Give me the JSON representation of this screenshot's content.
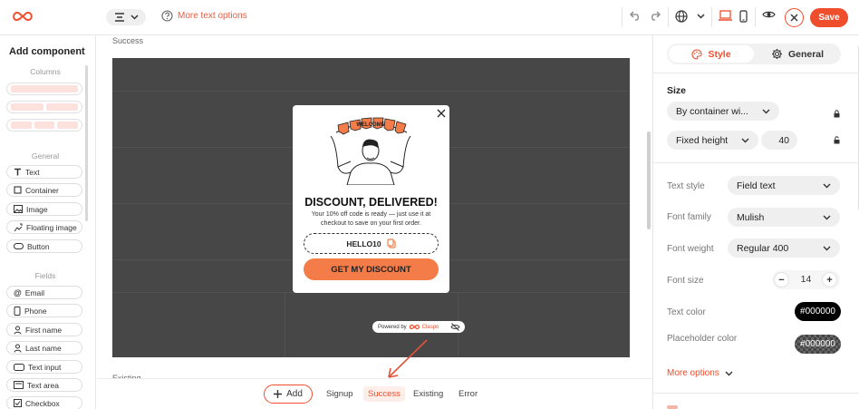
{
  "topbar": {
    "more_text_options": "More text options",
    "save_label": "Save"
  },
  "left_panel": {
    "title": "Add component",
    "columns_label": "Columns",
    "general_label": "General",
    "general_items": [
      "Text",
      "Container",
      "Image",
      "Floating image",
      "Button"
    ],
    "fields_label": "Fields",
    "field_items": [
      "Email",
      "Phone",
      "First name",
      "Last name",
      "Text input",
      "Text area",
      "Checkbox"
    ]
  },
  "canvas": {
    "label": "Success",
    "label_below": "Existing"
  },
  "popup": {
    "banner": "WELCOME",
    "headline": "DISCOUNT, DELIVERED!",
    "body": "Your 10% off code is ready — just use it at checkout to save on your first order.",
    "code": "HELLO10",
    "cta": "GET MY DISCOUNT",
    "powered_by": "Powered by",
    "brand": "Claspo"
  },
  "bottom_bar": {
    "add_label": "Add",
    "tabs": [
      "Signup",
      "Success",
      "Existing",
      "Error"
    ],
    "active_tab": "Success"
  },
  "right_panel": {
    "tabs": {
      "style": "Style",
      "general": "General"
    },
    "size_title": "Size",
    "width_mode": "By container wi...",
    "height_mode": "Fixed height",
    "height_value": "40",
    "text_style_label": "Text style",
    "text_style_value": "Field text",
    "font_family_label": "Font family",
    "font_family_value": "Mulish",
    "font_weight_label": "Font weight",
    "font_weight_value": "Regular 400",
    "font_size_label": "Font size",
    "font_size_value": "14",
    "text_color_label": "Text color",
    "text_color_value": "#000000",
    "placeholder_color_label": "Placeholder color",
    "placeholder_color_value": "#000000",
    "more_options": "More options"
  },
  "colors": {
    "accent": "#ef4e2d",
    "cta": "#f47c48",
    "canvas_bg": "#474747"
  }
}
